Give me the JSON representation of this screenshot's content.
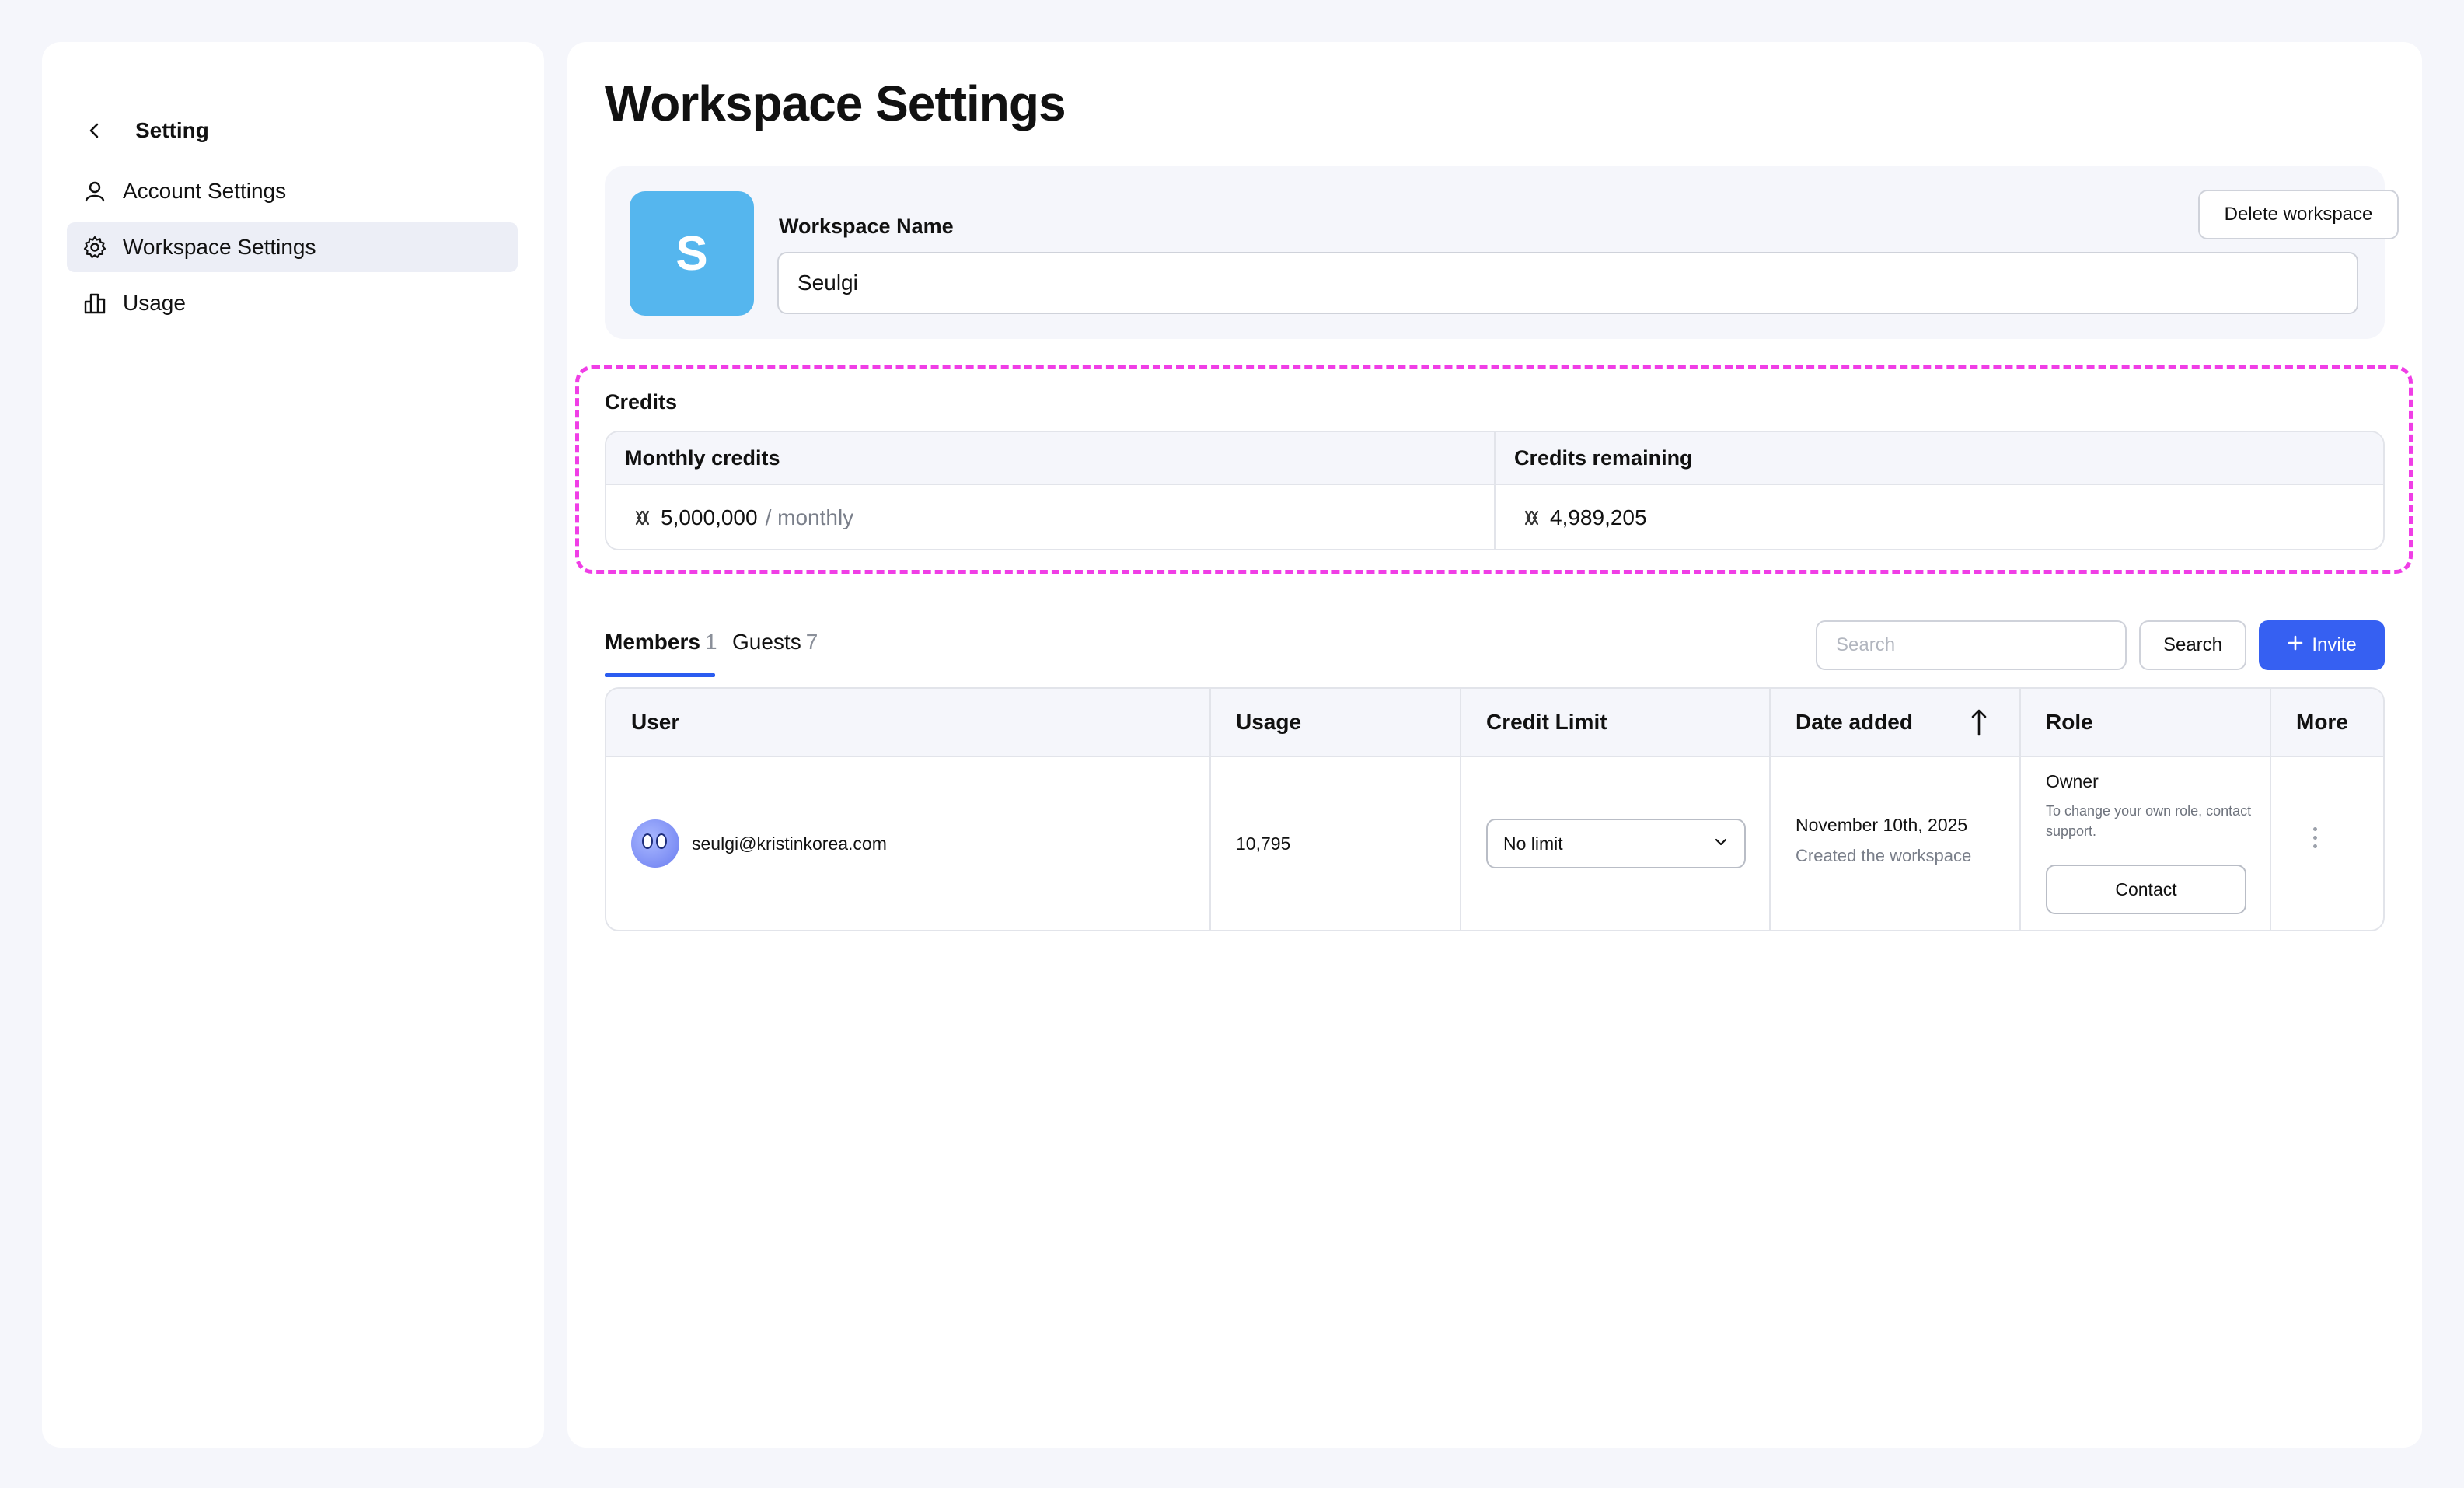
{
  "sidebar": {
    "title": "Setting",
    "items": [
      {
        "label": "Account Settings",
        "icon": "user-icon"
      },
      {
        "label": "Workspace Settings",
        "icon": "gear-icon",
        "active": true
      },
      {
        "label": "Usage",
        "icon": "bar-chart-icon"
      }
    ]
  },
  "page": {
    "title": "Workspace Settings"
  },
  "workspace": {
    "avatar_letter": "S",
    "avatar_color": "#55b6ee",
    "name_label": "Workspace Name",
    "name_value": "Seulgi",
    "delete_label": "Delete workspace"
  },
  "credits": {
    "title": "Credits",
    "monthly_header": "Monthly credits",
    "monthly_value": "5,000,000",
    "monthly_suffix": "/ monthly",
    "remaining_header": "Credits remaining",
    "remaining_value": "4,989,205",
    "highlight_color": "#f03ee6"
  },
  "tabs": [
    {
      "label": "Members",
      "count": "1",
      "active": true
    },
    {
      "label": "Guests",
      "count": "7",
      "active": false
    }
  ],
  "toolbar": {
    "search_placeholder": "Search",
    "search_label": "Search",
    "invite_label": "Invite",
    "accent": "#3660f2"
  },
  "members_table": {
    "headers": {
      "user": "User",
      "usage": "Usage",
      "credit_limit": "Credit Limit",
      "date_added": "Date added",
      "role": "Role",
      "more": "More"
    },
    "rows": [
      {
        "email": "seulgi@kristinkorea.com",
        "usage": "10,795",
        "credit_limit": "No limit",
        "date_added": "November 10th, 2025",
        "date_note": "Created the workspace",
        "role": "Owner",
        "role_note": "To change your own role, contact support.",
        "contact_label": "Contact"
      }
    ]
  }
}
